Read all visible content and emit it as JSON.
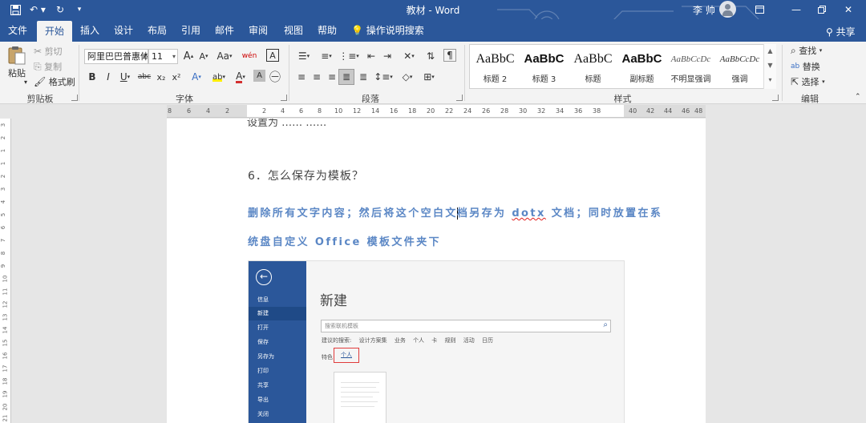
{
  "titlebar": {
    "title": "教材 - Word",
    "user": "李 帅",
    "qa_icons": [
      "save-icon",
      "undo-icon",
      "redo-icon",
      "customize-icon"
    ]
  },
  "tabs": [
    "文件",
    "开始",
    "插入",
    "设计",
    "布局",
    "引用",
    "邮件",
    "审阅",
    "视图",
    "帮助"
  ],
  "active_tab": "开始",
  "tell_me": "操作说明搜索",
  "share": "共享",
  "ribbon": {
    "clipboard": {
      "label": "剪贴板",
      "paste": "粘贴",
      "cut": "剪切",
      "copy": "复制",
      "format_painter": "格式刷"
    },
    "font": {
      "label": "字体",
      "font_name": "阿里巴巴普惠体",
      "font_size": "11",
      "grow": "A",
      "shrink": "A",
      "case": "Aa",
      "wen": "wén",
      "border_char": "A",
      "bold": "B",
      "italic": "I",
      "underline": "U",
      "strike": "abc",
      "sub": "x₂",
      "sup": "x²",
      "effects": "A",
      "highlight": "ab",
      "font_color": "A",
      "shading": "A"
    },
    "paragraph": {
      "label": "段落"
    },
    "styles": {
      "label": "样式",
      "items": [
        {
          "sample": "AaBbC",
          "name": "标题 2"
        },
        {
          "sample": "AaBbC",
          "name": "标题 3"
        },
        {
          "sample": "AaBbC",
          "name": "标题"
        },
        {
          "sample": "AaBbC",
          "name": "副标题"
        },
        {
          "sample": "AaBbCcDc",
          "name": "不明显强调"
        },
        {
          "sample": "AaBbCcDc",
          "name": "强调"
        }
      ]
    },
    "editing": {
      "label": "编辑",
      "find": "查找",
      "replace": "替换",
      "select": "选择"
    }
  },
  "ruler": {
    "left_ticks": [
      "8",
      "6",
      "4",
      "2"
    ],
    "right_ticks": [
      "2",
      "4",
      "6",
      "8",
      "10",
      "12",
      "14",
      "16",
      "18",
      "20",
      "22",
      "24",
      "26",
      "28",
      "30",
      "32",
      "34",
      "36",
      "38",
      "40",
      "42",
      "44",
      "46",
      "48"
    ]
  },
  "vruler": [
    "3",
    "2",
    "1",
    "1",
    "2",
    "3",
    "4",
    "5",
    "6",
    "7",
    "8",
    "9",
    "10",
    "11",
    "12",
    "13",
    "14",
    "15",
    "16",
    "17",
    "18",
    "19",
    "20",
    "21"
  ],
  "document": {
    "cut_line": "设置为  ……  ……",
    "heading": "6．怎么保存为模板？",
    "para1_a": "删除所有文字内容；然后将这个空白文",
    "para1_b": "档另存为 ",
    "para1_dotx": "dotx",
    "para1_c": " 文档；同时放置在系",
    "para2": "统盘自定义 Office 模板文件夹下"
  },
  "embedded": {
    "menu": [
      "信息",
      "新建",
      "打开",
      "保存",
      "另存为",
      "打印",
      "共享",
      "导出",
      "关闭"
    ],
    "selected_menu": "新建",
    "title": "新建",
    "search_placeholder": "搜索联机模板",
    "suggest_label": "建议的搜索:",
    "suggestions": [
      "设计方案集",
      "业务",
      "个人",
      "卡",
      "规则",
      "活动",
      "日历"
    ],
    "featured": "特色",
    "personal": "个人"
  }
}
